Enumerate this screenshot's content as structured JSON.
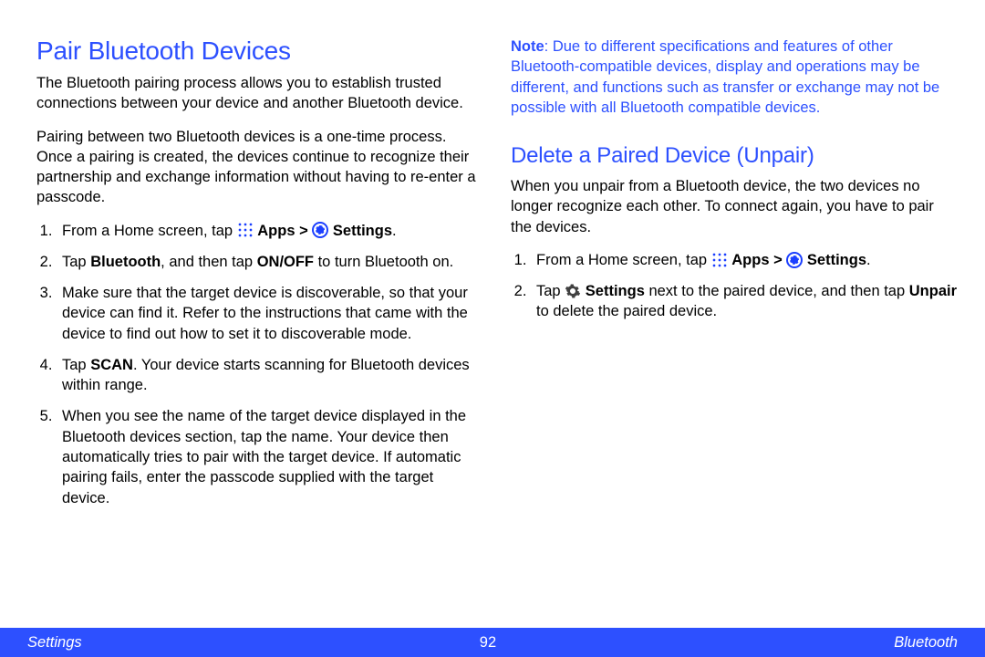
{
  "left": {
    "title": "Pair Bluetooth Devices",
    "p1": "The Bluetooth pairing process allows you to establish trusted connections between your device and another Bluetooth device.",
    "p2": "Pairing between two Bluetooth devices is a one-time process. Once a pairing is created, the devices continue to recognize their partnership and exchange information without having to re-enter a passcode.",
    "steps": {
      "s1_a": "From a Home screen, tap ",
      "s1_apps": "Apps",
      "s1_gt": " > ",
      "s1_settings": "Settings",
      "s1_end": ".",
      "s2_a": "Tap ",
      "s2_bt": "Bluetooth",
      "s2_b": ", and then tap ",
      "s2_onoff": "ON/OFF",
      "s2_c": " to turn Bluetooth on.",
      "s3": "Make sure that the target device is discoverable, so that your device can find it. Refer to the instructions that came with the device to find out how to set it to discoverable mode.",
      "s4_a": "Tap ",
      "s4_scan": "SCAN",
      "s4_b": ". Your device starts scanning for Bluetooth devices within range.",
      "s5": "When you see the name of the target device displayed in the Bluetooth devices section, tap the name. Your device then automatically tries to pair with the target device. If automatic pairing fails, enter the passcode supplied with the target device."
    }
  },
  "right": {
    "note_label": "Note",
    "note_body": ": Due to different specifications and features of other Bluetooth-compatible devices, display and operations may be different, and functions such as transfer or exchange may not be possible with all Bluetooth compatible devices.",
    "title": "Delete a Paired Device (Unpair)",
    "p1": "When you unpair from a Bluetooth device, the two devices no longer recognize each other. To connect again, you have to pair the devices.",
    "steps": {
      "s1_a": "From a Home screen, tap ",
      "s1_apps": "Apps",
      "s1_gt": " > ",
      "s1_settings": "Settings",
      "s1_end": ".",
      "s2_a": "Tap ",
      "s2_settings": "Settings",
      "s2_b": " next to the paired device, and then tap ",
      "s2_unpair": "Unpair",
      "s2_c": " to delete the paired device."
    }
  },
  "footer": {
    "left": "Settings",
    "center": "92",
    "right": "Bluetooth"
  }
}
